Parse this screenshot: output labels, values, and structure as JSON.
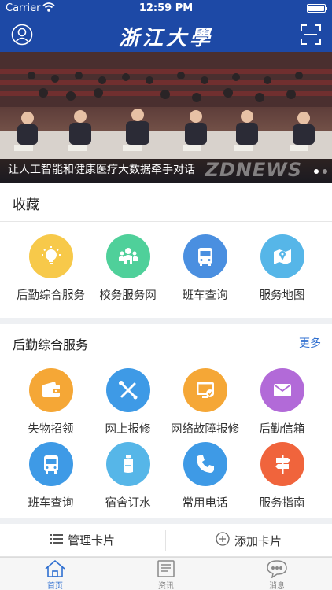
{
  "status_bar": {
    "carrier": "Carrier",
    "time": "12:59 PM"
  },
  "nav": {
    "title": "浙江大學",
    "icons": [
      "user-icon",
      "scan-icon"
    ]
  },
  "banner": {
    "caption": "让人工智能和健康医疗大数据牵手对话",
    "watermark": "ZDNEWS",
    "page_count": 2,
    "active_page": 1
  },
  "favorites": {
    "title": "收藏",
    "items": [
      {
        "label": "后勤综合服务",
        "icon": "lightbulb-icon",
        "color": "#f7c94a"
      },
      {
        "label": "校务服务网",
        "icon": "people-icon",
        "color": "#4fd09a"
      },
      {
        "label": "班车查询",
        "icon": "bus-icon",
        "color": "#4a8fe0"
      },
      {
        "label": "服务地图",
        "icon": "map-icon",
        "color": "#56b6e8"
      }
    ]
  },
  "logistics": {
    "title": "后勤综合服务",
    "more": "更多",
    "items": [
      {
        "label": "失物招领",
        "icon": "wallet-icon",
        "color": "#f5a736"
      },
      {
        "label": "网上报修",
        "icon": "tools-icon",
        "color": "#3e9ae6"
      },
      {
        "label": "网络故障报修",
        "icon": "monitor-icon",
        "color": "#f5a736"
      },
      {
        "label": "后勤信箱",
        "icon": "mail-icon",
        "color": "#b26ad8"
      },
      {
        "label": "班车查询",
        "icon": "bus-icon",
        "color": "#3e9ae6"
      },
      {
        "label": "宿舍订水",
        "icon": "water-bottle-icon",
        "color": "#56b6e8"
      },
      {
        "label": "常用电话",
        "icon": "phone-icon",
        "color": "#3e9ae6"
      },
      {
        "label": "服务指南",
        "icon": "signpost-icon",
        "color": "#f0643c"
      }
    ]
  },
  "actions": {
    "manage": "管理卡片",
    "add": "添加卡片"
  },
  "tabs": [
    {
      "label": "首页",
      "icon": "home-icon",
      "active": true
    },
    {
      "label": "资讯",
      "icon": "news-icon",
      "active": false
    },
    {
      "label": "消息",
      "icon": "message-icon",
      "active": false
    }
  ],
  "colors": {
    "brand": "#1d49a6",
    "link": "#2f6fd0"
  }
}
